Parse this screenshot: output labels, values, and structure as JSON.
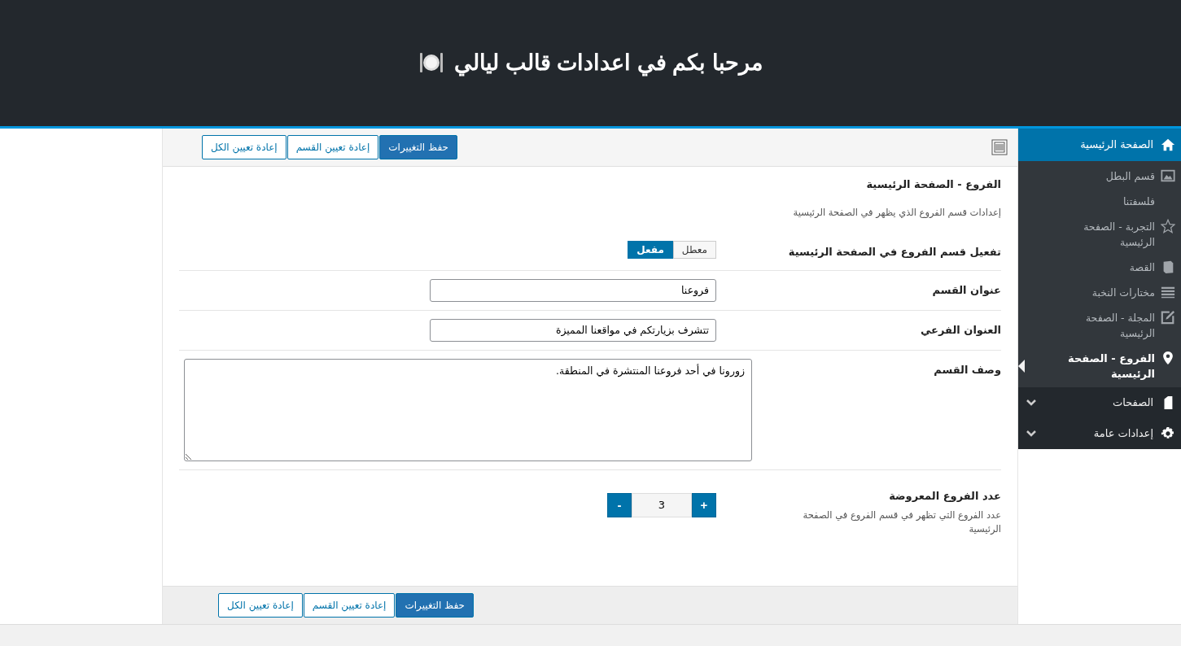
{
  "header": {
    "title": "مرحبا بكم في اعدادات قالب ليالي"
  },
  "sidebar": {
    "items": [
      {
        "label": "الصفحة الرئيسية",
        "kind": "top",
        "expanded": true,
        "children": [
          {
            "label": "قسم البطل",
            "selected": false
          },
          {
            "label": "فلسفتنا",
            "selected": false
          },
          {
            "label": "التجربة - الصفحة الرئيسية",
            "selected": false
          },
          {
            "label": "القصة",
            "selected": false
          },
          {
            "label": "مختارات النخبة",
            "selected": false
          },
          {
            "label": "المجلة - الصفحة الرئيسية",
            "selected": false
          },
          {
            "label": "الفروع - الصفحة الرئيسية",
            "selected": true
          }
        ]
      },
      {
        "label": "الصفحات",
        "kind": "top",
        "expanded": false
      },
      {
        "label": "إعدادات عامة",
        "kind": "top",
        "expanded": false
      }
    ]
  },
  "toolbar_top": {
    "buttons": [
      {
        "label": "حفظ التغييرات",
        "kind": "primary"
      },
      {
        "label": "إعادة تعيين القسم",
        "kind": "secondary"
      },
      {
        "label": "إعادة تعيين الكل",
        "kind": "secondary"
      }
    ]
  },
  "section": {
    "title": "الفروع - الصفحة الرئيسية",
    "description": "إعدادات قسم الفروع الذي يظهر في الصفحة الرئيسية"
  },
  "fields": [
    {
      "kind": "toggle",
      "label": "تفعيل قسم الفروع في الصفحة الرئيسية",
      "options": [
        {
          "label": "معطل",
          "selected": false
        },
        {
          "label": "مفعل",
          "selected": true
        }
      ]
    },
    {
      "kind": "text",
      "label": "عنوان القسم",
      "value": "فروعنا"
    },
    {
      "kind": "text",
      "label": "العنوان الفرعي",
      "value": "تتشرف بزيارتكم في مواقعنا المميزة"
    },
    {
      "kind": "textarea",
      "label": "وصف القسم",
      "value": "زورونا في أحد فروعنا المنتشرة في المنطقة."
    },
    {
      "kind": "number",
      "label": "عدد الفروع المعروضة",
      "description": "عدد الفروع التي تظهر في قسم الفروع في الصفحة الرئيسية",
      "value": "3",
      "increment": "+",
      "decrement": "-"
    }
  ],
  "toolbar_bottom": {
    "buttons": [
      {
        "label": "حفظ التغييرات",
        "kind": "primary"
      },
      {
        "label": "إعادة تعيين القسم",
        "kind": "secondary"
      },
      {
        "label": "إعادة تعيين الكل",
        "kind": "secondary"
      }
    ]
  }
}
